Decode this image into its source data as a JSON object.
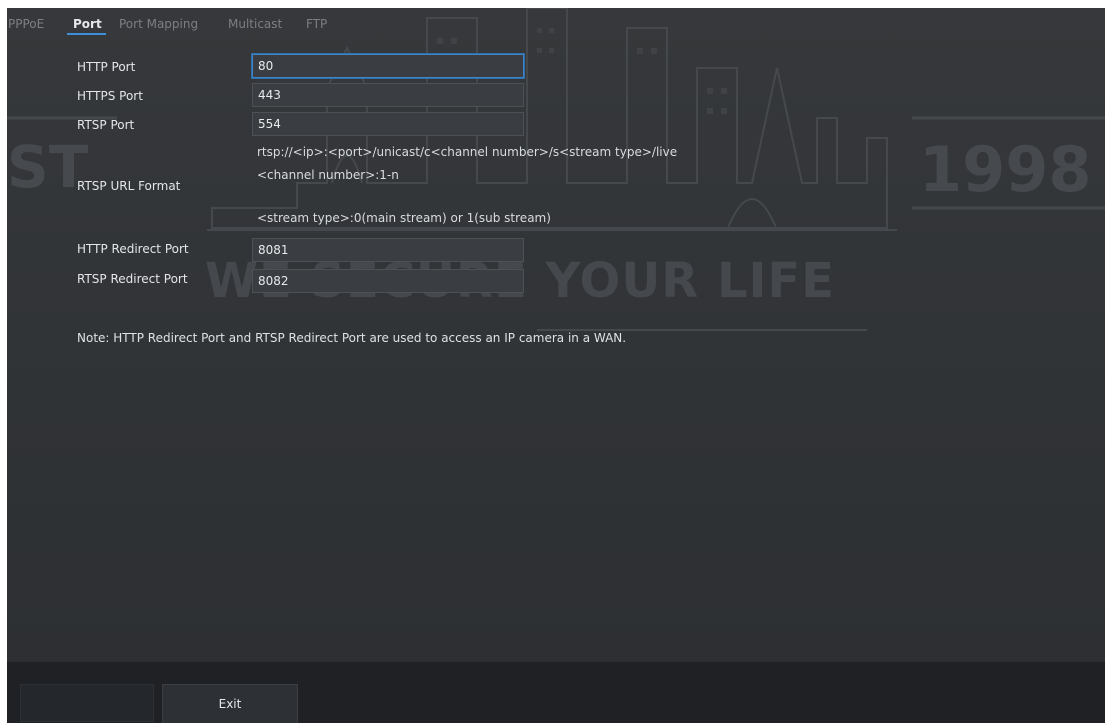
{
  "tabs": [
    {
      "label": "PPPoE"
    },
    {
      "label": "Port"
    },
    {
      "label": "Port Mapping"
    },
    {
      "label": "Multicast"
    },
    {
      "label": "FTP"
    }
  ],
  "active_tab": "Port",
  "form": {
    "http_port": {
      "label": "HTTP Port",
      "value": "80"
    },
    "https_port": {
      "label": "HTTPS Port",
      "value": "443"
    },
    "rtsp_port": {
      "label": "RTSP Port",
      "value": "554"
    },
    "rtsp_url_format": {
      "label": "RTSP URL Format",
      "line1": "rtsp://<ip>:<port>/unicast/c<channel number>/s<stream type>/live",
      "line2": "<channel number>:1-n",
      "line3": "<stream type>:0(main stream) or 1(sub stream)"
    },
    "http_redirect_port": {
      "label": "HTTP Redirect Port",
      "value": "8081"
    },
    "rtsp_redirect_port": {
      "label": "RTSP Redirect Port",
      "value": "8082"
    }
  },
  "note": "Note: HTTP Redirect Port and RTSP Redirect Port are used to access an IP camera in a WAN.",
  "watermark": {
    "left_text": "ST",
    "right_text": "1998",
    "slogan": "WE SECURE YOUR LIFE"
  },
  "footer": {
    "exit_label": "Exit"
  },
  "colors": {
    "accent": "#3d8fd9",
    "background": "#303336",
    "footer": "#1f2124"
  }
}
